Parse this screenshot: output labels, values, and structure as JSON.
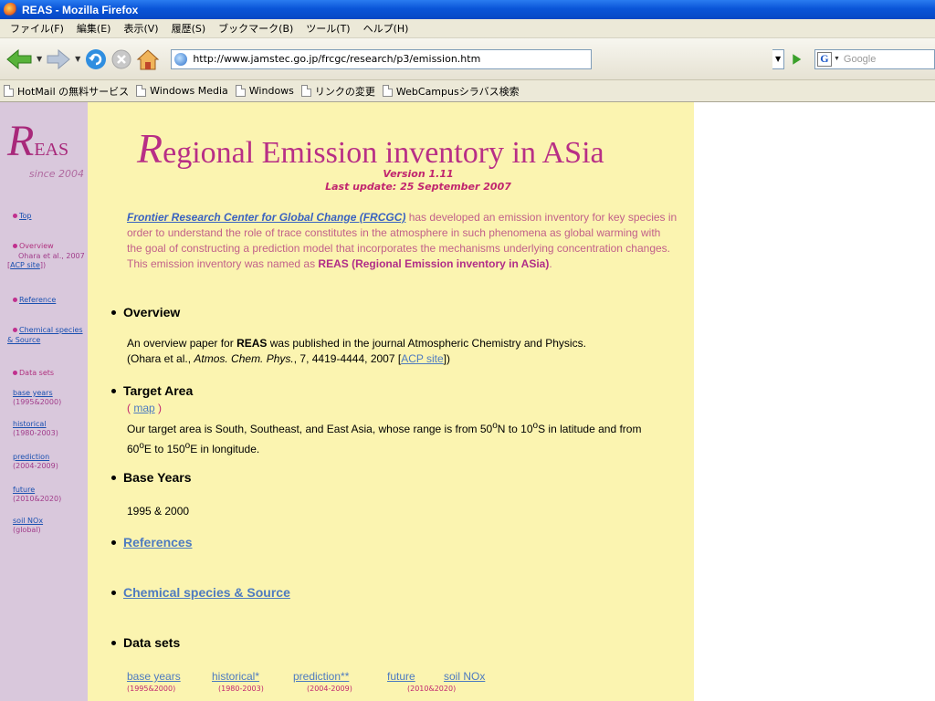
{
  "window": {
    "title": "REAS - Mozilla Firefox"
  },
  "menu": [
    "ファイル(F)",
    "編集(E)",
    "表示(V)",
    "履歴(S)",
    "ブックマーク(B)",
    "ツール(T)",
    "ヘルプ(H)"
  ],
  "navbar": {
    "url": "http://www.jamstec.go.jp/frcgc/research/p3/emission.htm",
    "search_placeholder": "Google"
  },
  "bookmarks": [
    "HotMail の無料サービス",
    "Windows Media",
    "Windows",
    "リンクの変更",
    "WebCampusシラバス検索"
  ],
  "sidebar": {
    "logo_r": "R",
    "logo_rest": "EAS",
    "since": "since 2004",
    "top": "Top",
    "overview": "Overview",
    "ohara": "Ohara et al., 2007",
    "acp": "ACP site",
    "reference": "Reference",
    "chemical": "Chemical species",
    "source": "& Source",
    "datasets": "Data sets",
    "base_years": "base years",
    "base_years_range": "(1995&2000)",
    "historical": "historical",
    "historical_range": "(1980-2003)",
    "prediction": "prediction",
    "prediction_range": "(2004-2009)",
    "future": "future",
    "future_range": "(2010&2020)",
    "soil": "soil NOx",
    "soil_range": "(global)"
  },
  "main": {
    "title_r": "R",
    "title_rest": "egional Emission inventory in ASia",
    "version": "Version 1.11",
    "last_update": "Last update: 25 September 2007",
    "intro_link": "Frontier Research Center for Global Change (FRCGC)",
    "intro_text": " has developed an emission inventory for key species in order to understand the role of trace constitutes in the atmosphere in such phenomena as global warming with the goal of constructing a prediction model that incorporates the mechanisms underlying concentration changes.   This emission inventory was named as ",
    "intro_bold": "REAS (Regional Emission inventory in ASia)",
    "intro_end": ".",
    "overview_h": "Overview",
    "overview_1a": "An overview paper for ",
    "overview_1b": "REAS",
    "overview_1c": " was published in the journal Atmospheric Chemistry and Physics.",
    "overview_2a": "(Ohara et al., ",
    "overview_2b": "Atmos. Chem. Phys.",
    "overview_2c": ", 7, 4419-4444, 2007 [",
    "overview_2d": "ACP site",
    "overview_2e": "])",
    "target_h": "Target Area",
    "map_open": "( ",
    "map_link": "map",
    "map_close": " )",
    "target_1a": "Our target area is South, Southeast, and East Asia,   whose range is from 50",
    "target_deg": "o",
    "target_1b": "N to 10",
    "target_1c": "S in latitude and from",
    "target_2a": "60",
    "target_2b": "E to 150",
    "target_2c": "E in longitude.",
    "base_h": "Base Years",
    "base_text": "1995 & 2000",
    "references_h": "References",
    "chemical_h": "Chemical species & Source",
    "datasets_h": "Data sets",
    "ds": [
      {
        "label": "base years",
        "range": "(1995&2000)"
      },
      {
        "label": "historical*",
        "range": "(1980-2003)"
      },
      {
        "label": "prediction**",
        "range": "(2004-2009)"
      },
      {
        "label": "future",
        "range": "(2010&2020)"
      },
      {
        "label": "soil NOx",
        "range": ""
      }
    ]
  }
}
